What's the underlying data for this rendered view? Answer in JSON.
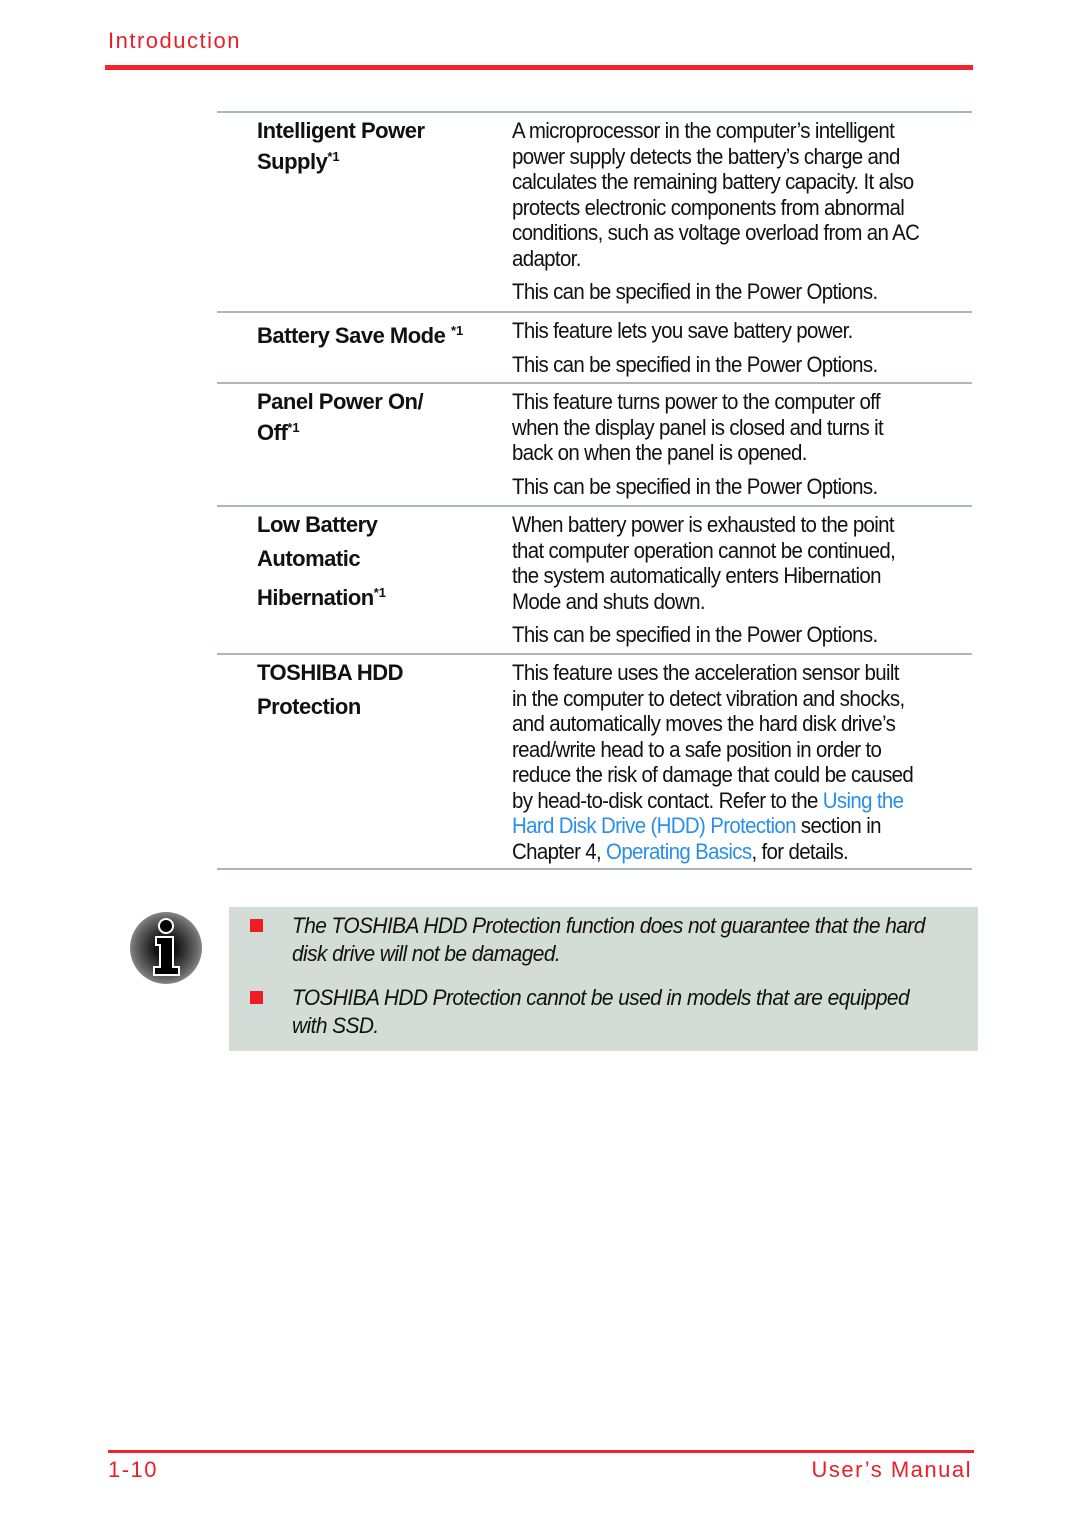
{
  "header": {
    "section": "Introduction"
  },
  "rows": [
    {
      "term": [
        "Intelligent Power",
        "Supply"
      ],
      "sup": "*1",
      "paras": [
        [
          [
            "A microprocessor in the computer’s intelligent"
          ],
          [
            "power supply detects the battery’s charge and"
          ],
          [
            "calculates the remaining battery capacity. It also"
          ],
          [
            "protects electronic components from abnormal"
          ],
          [
            "conditions, such as voltage overload from an AC"
          ],
          [
            "adaptor."
          ]
        ],
        [
          [
            "This can be specified in the Power Options."
          ]
        ]
      ]
    },
    {
      "term": [
        "Battery Save Mode "
      ],
      "sup": "*1",
      "paras": [
        [
          [
            "This feature lets you save battery power."
          ]
        ],
        [
          [
            "This can be specified in the Power Options."
          ]
        ]
      ]
    },
    {
      "term": [
        "Panel Power On/",
        "Off"
      ],
      "sup": "*1",
      "paras": [
        [
          [
            "This feature turns power to the computer off"
          ],
          [
            "when the display panel is closed and turns it"
          ],
          [
            "back on when the panel is opened."
          ]
        ],
        [
          [
            "This can be specified in the Power Options."
          ]
        ]
      ]
    },
    {
      "term": [
        "Low Battery",
        "Automatic",
        "Hibernation"
      ],
      "sup": "*1",
      "paras": [
        [
          [
            "When battery power is exhausted to the point"
          ],
          [
            "that computer operation cannot be continued,"
          ],
          [
            "the system automatically enters Hibernation"
          ],
          [
            "Mode and shuts down."
          ]
        ],
        [
          [
            "This can be specified in the Power Options."
          ]
        ]
      ]
    },
    {
      "term": [
        "TOSHIBA HDD",
        "Protection"
      ],
      "sup": "",
      "paras": [
        [
          [
            "This feature uses the acceleration sensor built"
          ],
          [
            "in the computer to detect vibration and shocks,"
          ],
          [
            "and automatically moves the hard disk drive’s"
          ],
          [
            "read/write head to a safe position in order to"
          ],
          [
            "reduce the risk of damage that could be caused"
          ],
          [
            "by head-to-disk contact. Refer to the ",
            {
              "link": "Using the"
            }
          ],
          [
            {
              "link": "Hard Disk Drive (HDD) Protection"
            },
            " section in"
          ],
          [
            "Chapter 4, ",
            {
              "link": "Operating Basics"
            },
            ", for details."
          ]
        ]
      ]
    }
  ],
  "note": {
    "icon": "info-icon",
    "items": [
      [
        "The TOSHIBA HDD Protection function does not guarantee that the hard",
        "disk drive will not be damaged."
      ],
      [
        "TOSHIBA HDD Protection cannot be used in models that are equipped",
        "with SSD."
      ]
    ]
  },
  "footer": {
    "page": "1-10",
    "title": "User’s Manual"
  },
  "colors": {
    "accent": "#f0262c",
    "link": "#2a8fe8",
    "note_bg": "#d3dcd7"
  }
}
